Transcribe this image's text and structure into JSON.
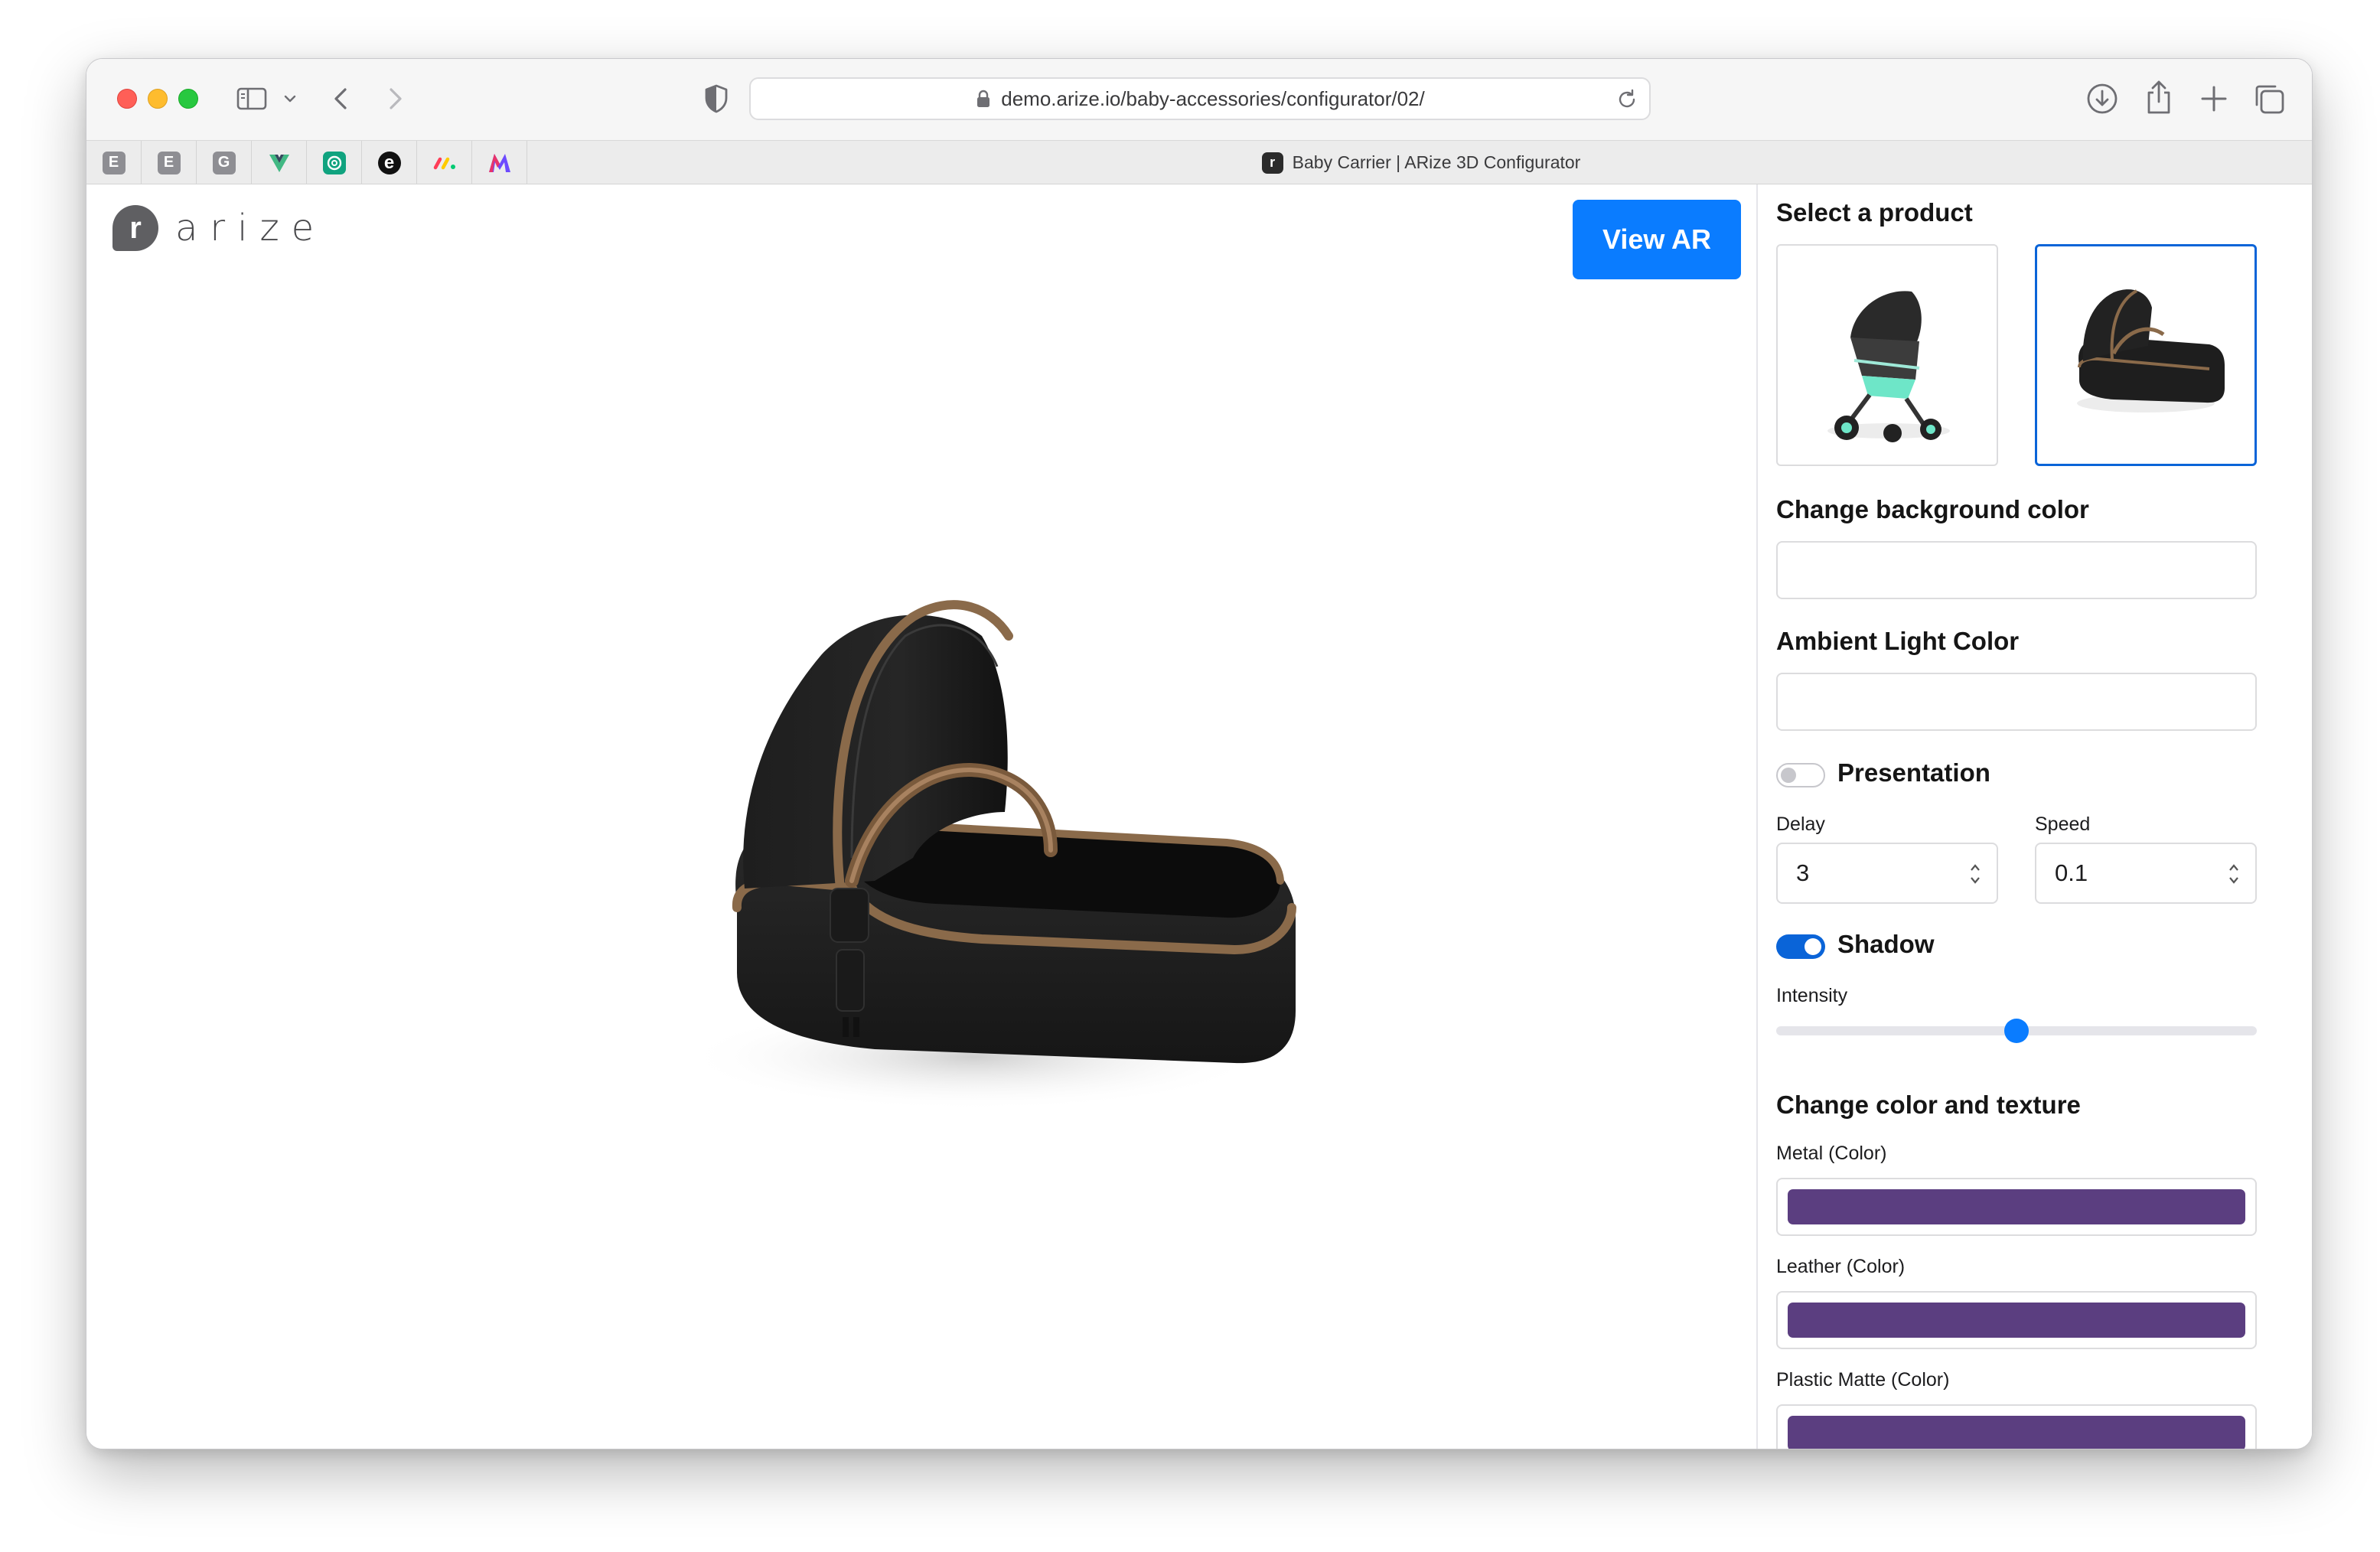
{
  "browser": {
    "url": "demo.arize.io/baby-accessories/configurator/02/",
    "active_tab_title": "Baby Carrier | ARize 3D Configurator",
    "active_tab_favicon": "r",
    "pinned_tabs": [
      {
        "icon": "E",
        "color": "#8e8e93"
      },
      {
        "icon": "E",
        "color": "#8e8e93"
      },
      {
        "icon": "G",
        "color": "#8e8e93"
      },
      {
        "icon": "vue-icon",
        "color": "#41b883"
      },
      {
        "icon": "openai-icon",
        "color": "#10a37f"
      },
      {
        "icon": "e",
        "color": "#111111"
      },
      {
        "icon": "monday-icon",
        "color": "#ff3d57"
      },
      {
        "icon": "m-icon",
        "color": "#6d4aff"
      }
    ]
  },
  "app": {
    "logo_mark": "r",
    "logo_text": "arize",
    "view_ar_label": "View AR"
  },
  "panel": {
    "select_product_heading": "Select a product",
    "products": [
      {
        "name": "stroller",
        "selected": false
      },
      {
        "name": "baby-carrier",
        "selected": true
      }
    ],
    "background_heading": "Change background color",
    "ambient_heading": "Ambient Light Color",
    "presentation": {
      "label": "Presentation",
      "enabled": false
    },
    "delay": {
      "label": "Delay",
      "value": "3"
    },
    "speed": {
      "label": "Speed",
      "value": "0.1"
    },
    "shadow": {
      "label": "Shadow",
      "enabled": true
    },
    "intensity": {
      "label": "Intensity",
      "value": 0.5
    },
    "texture_heading": "Change color and texture",
    "materials": [
      {
        "label": "Metal (Color)",
        "color": "#5b3e80"
      },
      {
        "label": "Leather (Color)",
        "color": "#5b3e80"
      },
      {
        "label": "Plastic Matte (Color)",
        "color": "#5b3e80"
      }
    ]
  },
  "colors": {
    "accent": "#0a7cff",
    "toggle_on": "#0a64d8"
  }
}
